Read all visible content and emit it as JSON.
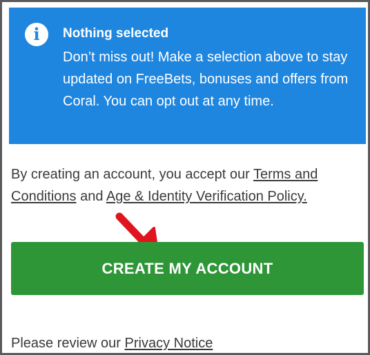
{
  "notice": {
    "icon": "info-icon",
    "title": "Nothing selected",
    "message": "Don’t miss out! Make a selection above to stay updated on FreeBets, bonuses and offers from Coral. You can opt out at any time.",
    "background_color": "#1f86e0"
  },
  "legal": {
    "prefix": "By creating an account, you accept our ",
    "terms_link": "Terms and Conditions",
    "conjunction": " and ",
    "policy_link": "Age & Identity Verification Policy."
  },
  "annotation": {
    "icon": "red-arrow-icon",
    "color": "#e0141e"
  },
  "create_button": {
    "label": "CREATE MY ACCOUNT",
    "color": "#2e9637"
  },
  "privacy": {
    "prefix": "Please review our ",
    "link": "Privacy Notice"
  }
}
